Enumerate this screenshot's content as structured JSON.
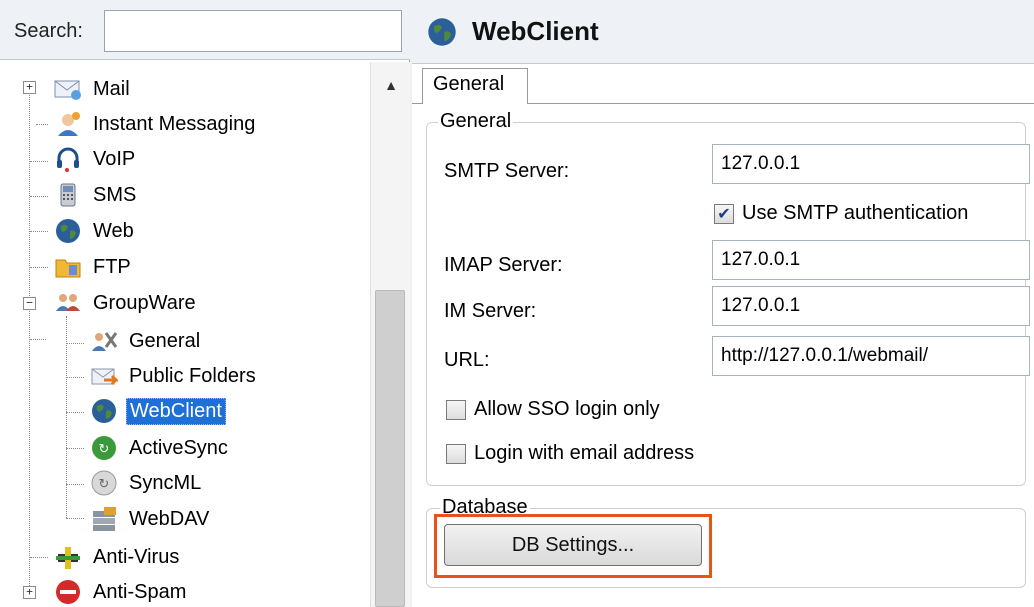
{
  "search": {
    "label": "Search:",
    "value": "",
    "placeholder": ""
  },
  "tree": {
    "items": [
      {
        "label": "Mail",
        "icon": "mail-icon"
      },
      {
        "label": "Instant Messaging",
        "icon": "instant-messaging-icon"
      },
      {
        "label": "VoIP",
        "icon": "headset-icon"
      },
      {
        "label": "SMS",
        "icon": "phone-icon"
      },
      {
        "label": "Web",
        "icon": "globe-icon"
      },
      {
        "label": "FTP",
        "icon": "folder-icon"
      },
      {
        "label": "GroupWare",
        "icon": "users-icon"
      },
      {
        "label": "General",
        "icon": "general-tools-icon"
      },
      {
        "label": "Public Folders",
        "icon": "public-folders-icon"
      },
      {
        "label": "WebClient",
        "icon": "globe-icon",
        "selected": true
      },
      {
        "label": "ActiveSync",
        "icon": "sync-green-icon"
      },
      {
        "label": "SyncML",
        "icon": "sync-gray-icon"
      },
      {
        "label": "WebDAV",
        "icon": "database-icon"
      },
      {
        "label": "Anti-Virus",
        "icon": "anti-virus-icon"
      },
      {
        "label": "Anti-Spam",
        "icon": "anti-spam-icon"
      }
    ]
  },
  "header": {
    "title": "WebClient"
  },
  "tabs": [
    {
      "label": "General",
      "active": true
    }
  ],
  "general_group": {
    "title": "General",
    "smtp_label": "SMTP Server:",
    "smtp_value": "127.0.0.1",
    "smtp_auth_label": "Use SMTP authentication",
    "smtp_auth_checked": true,
    "imap_label": "IMAP Server:",
    "imap_value": "127.0.0.1",
    "im_label": "IM Server:",
    "im_value": "127.0.0.1",
    "url_label": "URL:",
    "url_value": "http://127.0.0.1/webmail/",
    "sso_label": "Allow SSO login only",
    "sso_checked": false,
    "email_login_label": "Login with email address",
    "email_login_checked": false
  },
  "database_group": {
    "title": "Database",
    "button_label": "DB Settings..."
  },
  "colors": {
    "selection": "#1e6fd6",
    "highlight": "#e8531c"
  }
}
